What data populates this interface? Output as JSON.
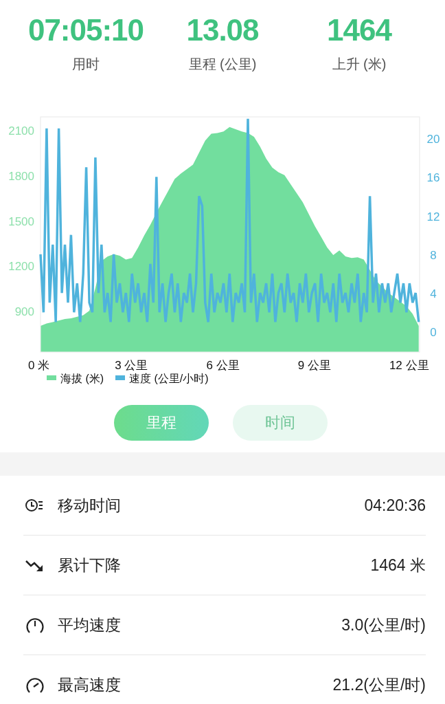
{
  "summary": [
    {
      "value": "07:05:10",
      "label": "用时"
    },
    {
      "value": "13.08",
      "label": "里程 (公里)"
    },
    {
      "value": "1464",
      "label": "上升 (米)"
    }
  ],
  "chart": {
    "elevation": {
      "chart_data": {
        "type": "area",
        "x": [
          0,
          0.2,
          0.4,
          0.6,
          0.8,
          1,
          1.2,
          1.4,
          1.6,
          1.8,
          2,
          2.2,
          2.4,
          2.6,
          2.8,
          3,
          3.2,
          3.4,
          3.6,
          3.8,
          4,
          4.2,
          4.4,
          4.6,
          4.8,
          5,
          5.2,
          5.4,
          5.6,
          5.8,
          6,
          6.2,
          6.4,
          6.6,
          6.8,
          7,
          7.2,
          7.4,
          7.6,
          7.8,
          8,
          8.2,
          8.4,
          8.6,
          8.8,
          9,
          9.2,
          9.4,
          9.6,
          9.8,
          10,
          10.2,
          10.4,
          10.6,
          10.8,
          11,
          11.2,
          11.4,
          11.6,
          11.8,
          12,
          12.2,
          12.4
        ],
        "series": [
          {
            "name": "海拔 (米)",
            "color": "#72de9e",
            "values": [
              800,
              815,
              825,
              835,
              845,
              850,
              860,
              870,
              900,
              1050,
              1230,
              1260,
              1275,
              1265,
              1240,
              1250,
              1320,
              1400,
              1470,
              1550,
              1625,
              1700,
              1775,
              1810,
              1840,
              1870,
              1950,
              2030,
              2075,
              2080,
              2090,
              2120,
              2105,
              2090,
              2080,
              2055,
              1990,
              1910,
              1850,
              1820,
              1800,
              1740,
              1680,
              1620,
              1540,
              1460,
              1390,
              1320,
              1270,
              1300,
              1260,
              1250,
              1255,
              1240,
              1170,
              1100,
              1060,
              1020,
              990,
              960,
              930,
              880,
              800
            ]
          }
        ],
        "xticks": [
          {
            "value": 0,
            "label": "0 米"
          },
          {
            "value": 3,
            "label": "3 公里"
          },
          {
            "value": 6,
            "label": "6 公里"
          },
          {
            "value": 9,
            "label": "9 公里"
          },
          {
            "value": 12,
            "label": "12 公里"
          }
        ],
        "xlim": [
          0,
          12.43
        ],
        "yticks": [
          900,
          1200,
          1500,
          1800,
          2100
        ],
        "ylim": [
          626,
          2187
        ]
      }
    },
    "speed": {
      "chart_data": {
        "type": "line",
        "x": [
          0,
          0.1,
          0.2,
          0.3,
          0.4,
          0.5,
          0.6,
          0.7,
          0.8,
          0.9,
          1,
          1.1,
          1.2,
          1.3,
          1.4,
          1.5,
          1.6,
          1.7,
          1.8,
          1.9,
          2,
          2.1,
          2.2,
          2.3,
          2.4,
          2.5,
          2.6,
          2.7,
          2.8,
          2.9,
          3,
          3.1,
          3.2,
          3.3,
          3.4,
          3.5,
          3.6,
          3.7,
          3.8,
          3.9,
          4,
          4.1,
          4.2,
          4.3,
          4.4,
          4.5,
          4.6,
          4.7,
          4.8,
          4.9,
          5,
          5.1,
          5.2,
          5.3,
          5.4,
          5.5,
          5.6,
          5.7,
          5.8,
          5.9,
          6,
          6.1,
          6.2,
          6.3,
          6.4,
          6.5,
          6.6,
          6.7,
          6.8,
          6.9,
          7,
          7.1,
          7.2,
          7.3,
          7.4,
          7.5,
          7.6,
          7.7,
          7.8,
          7.9,
          8,
          8.1,
          8.2,
          8.3,
          8.4,
          8.5,
          8.6,
          8.7,
          8.8,
          8.9,
          9,
          9.1,
          9.2,
          9.3,
          9.4,
          9.5,
          9.6,
          9.7,
          9.8,
          9.9,
          10,
          10.1,
          10.2,
          10.3,
          10.4,
          10.5,
          10.6,
          10.7,
          10.8,
          10.9,
          11,
          11.1,
          11.2,
          11.3,
          11.4,
          11.5,
          11.6,
          11.7,
          11.8,
          11.9,
          12,
          12.1,
          12.2,
          12.3,
          12.4
        ],
        "series": [
          {
            "name": "速度 (公里/小时)",
            "color": "#4fb3dc",
            "values": [
              8,
              2,
              21,
              3,
              9,
              1,
              21,
              4,
              9,
              3,
              10,
              2,
              5,
              1,
              6,
              17,
              3,
              2,
              18,
              4,
              9,
              2,
              4,
              1,
              8,
              3,
              5,
              2,
              4,
              1,
              6,
              3,
              5,
              2,
              4,
              1,
              7,
              3,
              16,
              2,
              5,
              1,
              4,
              6,
              2,
              5,
              1,
              4,
              3,
              6,
              2,
              5,
              14,
              13,
              3,
              1,
              6,
              2,
              4,
              3,
              5,
              2,
              6,
              1,
              4,
              3,
              5,
              2,
              22,
              3,
              6,
              1,
              4,
              3,
              5,
              2,
              6,
              1,
              4,
              5,
              2,
              6,
              3,
              4,
              1,
              5,
              3,
              6,
              2,
              4,
              5,
              1,
              6,
              3,
              4,
              2,
              5,
              1,
              6,
              3,
              4,
              2,
              5,
              3,
              6,
              1,
              4,
              2,
              14,
              3,
              6,
              2,
              5,
              3,
              5,
              2,
              4,
              6,
              3,
              5,
              2,
              5,
              3,
              4,
              1
            ]
          }
        ],
        "xlim": [
          0,
          12.43
        ],
        "yticks": [
          0,
          4,
          8,
          12,
          16,
          20
        ],
        "ylim": [
          -2.1,
          22.2
        ]
      }
    }
  },
  "modes": [
    {
      "label": "里程",
      "selected": true
    },
    {
      "label": "时间",
      "selected": false
    }
  ],
  "stats": [
    {
      "label": "移动时间",
      "value": "04:20:36"
    },
    {
      "label": "累计下降",
      "value": "1464 米"
    },
    {
      "label": "平均速度",
      "value": "3.0(公里/时)"
    },
    {
      "label": "最高速度",
      "value": "21.2(公里/时)"
    }
  ]
}
